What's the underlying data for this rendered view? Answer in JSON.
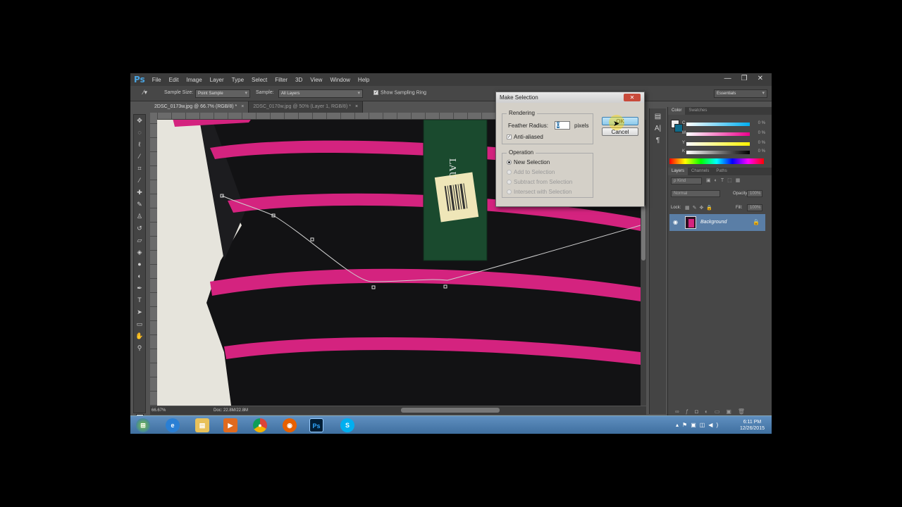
{
  "app": {
    "logo": "Ps",
    "window_controls": [
      "—",
      "❐",
      "✕"
    ]
  },
  "menu": [
    "File",
    "Edit",
    "Image",
    "Layer",
    "Type",
    "Select",
    "Filter",
    "3D",
    "View",
    "Window",
    "Help"
  ],
  "options": {
    "sample_size_label": "Sample Size:",
    "sample_size_value": "Point Sample",
    "sample_label": "Sample:",
    "sample_value": "All Layers",
    "show_ring_label": "Show Sampling Ring",
    "workspace": "Essentials"
  },
  "tabs": [
    {
      "label": "2DSC_0173w.jpg @ 66.7% (RGB/8) *",
      "close": "×"
    },
    {
      "label": "2DSC_0170w.jpg @ 50% (Layer 1, RGB/8) *",
      "close": "×"
    }
  ],
  "status": {
    "zoom": "66.67%",
    "doc": "Doc: 22.8M/22.8M"
  },
  "dialog": {
    "title": "Make Selection",
    "close": "✕",
    "rendering_title": "Rendering",
    "feather_label": "Feather Radius:",
    "feather_value": "0",
    "feather_unit": "pixels",
    "antialiased_label": "Anti-aliased",
    "operation_title": "Operation",
    "operations": [
      "New Selection",
      "Add to Selection",
      "Subtract from Selection",
      "Intersect with Selection"
    ],
    "ok_label": "OK",
    "cancel_label": "Cancel"
  },
  "color_panel": {
    "tabs": [
      "Color",
      "Swatches"
    ],
    "channels": [
      "C",
      "M",
      "Y",
      "K"
    ],
    "values": [
      "0",
      "0",
      "0",
      "0"
    ],
    "percent": "%"
  },
  "layers_panel": {
    "tabs": [
      "Layers",
      "Channels",
      "Paths"
    ],
    "kind": "ρ Kind",
    "blend_mode": "Normal",
    "opacity_label": "Opacity:",
    "opacity_value": "100%",
    "lock_label": "Lock:",
    "fill_label": "Fill:",
    "fill_value": "100%",
    "layer_name": "Background"
  },
  "clock": {
    "time": "6:11 PM",
    "date": "12/26/2015"
  },
  "colors": {
    "stripe": "#d4237f",
    "sweater": "#141416",
    "tag": "#1a4a2e",
    "accent": "#4aa3df"
  }
}
